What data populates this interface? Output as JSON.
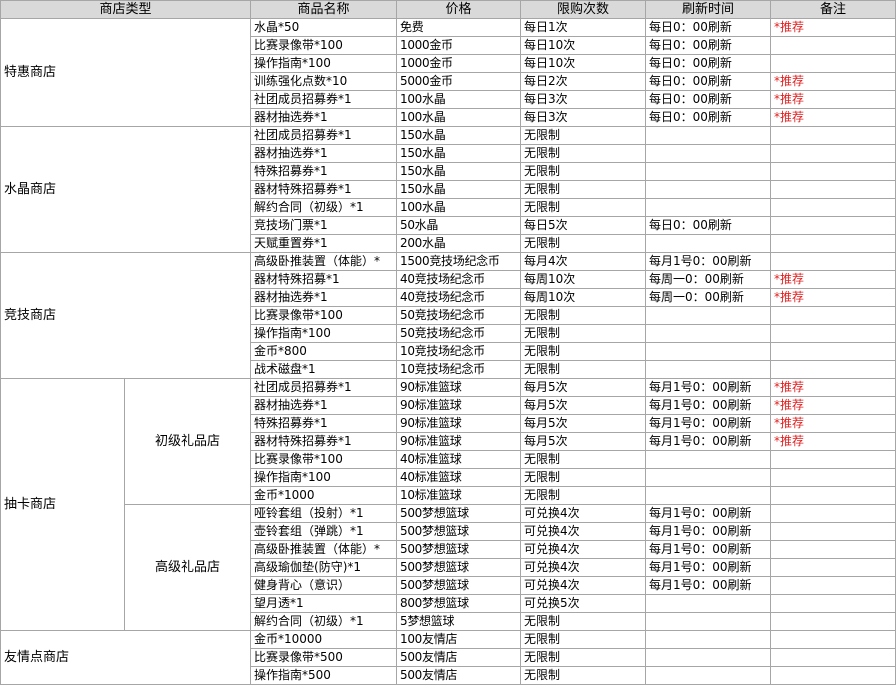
{
  "headers": [
    "商店类型",
    "商品名称",
    "价格",
    "限购次数",
    "刷新时间",
    "备注"
  ],
  "shops": [
    {
      "name": "特惠商店",
      "items": [
        [
          "水晶*50",
          "免费",
          "每日1次",
          "每日0：00刷新",
          "*推荐"
        ],
        [
          "比赛录像带*100",
          "1000金币",
          "每日10次",
          "每日0：00刷新",
          ""
        ],
        [
          "操作指南*100",
          "1000金币",
          "每日10次",
          "每日0：00刷新",
          ""
        ],
        [
          "训练强化点数*10",
          "5000金币",
          "每日2次",
          "每日0：00刷新",
          "*推荐"
        ],
        [
          "社团成员招募券*1",
          "100水晶",
          "每日3次",
          "每日0：00刷新",
          "*推荐"
        ],
        [
          "器材抽选券*1",
          "100水晶",
          "每日3次",
          "每日0：00刷新",
          "*推荐"
        ]
      ]
    },
    {
      "name": "水晶商店",
      "items": [
        [
          "社团成员招募券*1",
          "150水晶",
          "无限制",
          "",
          ""
        ],
        [
          "器材抽选券*1",
          "150水晶",
          "无限制",
          "",
          ""
        ],
        [
          "特殊招募券*1",
          "150水晶",
          "无限制",
          "",
          ""
        ],
        [
          "器材特殊招募券*1",
          "150水晶",
          "无限制",
          "",
          ""
        ],
        [
          "解约合同（初级）*1",
          "100水晶",
          "无限制",
          "",
          ""
        ],
        [
          "竞技场门票*1",
          "50水晶",
          "每日5次",
          "每日0：00刷新",
          ""
        ],
        [
          "天赋重置券*1",
          "200水晶",
          "无限制",
          "",
          ""
        ]
      ]
    },
    {
      "name": "竞技商店",
      "items": [
        [
          "高级卧推装置（体能）*",
          "1500竞技场纪念币",
          "每月4次",
          "每月1号0：00刷新",
          ""
        ],
        [
          "器材特殊招募*1",
          "40竞技场纪念币",
          "每周10次",
          "每周一0：00刷新",
          "*推荐"
        ],
        [
          "器材抽选券*1",
          "40竞技场纪念币",
          "每周10次",
          "每周一0：00刷新",
          "*推荐"
        ],
        [
          "比赛录像带*100",
          "50竞技场纪念币",
          "无限制",
          "",
          ""
        ],
        [
          "操作指南*100",
          "50竞技场纪念币",
          "无限制",
          "",
          ""
        ],
        [
          "金币*800",
          "10竞技场纪念币",
          "无限制",
          "",
          ""
        ],
        [
          "战术磁盘*1",
          "10竞技场纪念币",
          "无限制",
          "",
          ""
        ]
      ]
    },
    {
      "name": "抽卡商店",
      "subs": [
        {
          "name": "初级礼品店",
          "items": [
            [
              "社团成员招募券*1",
              "90标准篮球",
              "每月5次",
              "每月1号0：00刷新",
              "*推荐"
            ],
            [
              "器材抽选券*1",
              "90标准篮球",
              "每月5次",
              "每月1号0：00刷新",
              "*推荐"
            ],
            [
              "特殊招募券*1",
              "90标准篮球",
              "每月5次",
              "每月1号0：00刷新",
              "*推荐"
            ],
            [
              "器材特殊招募券*1",
              "90标准篮球",
              "每月5次",
              "每月1号0：00刷新",
              "*推荐"
            ],
            [
              "比赛录像带*100",
              "40标准篮球",
              "无限制",
              "",
              ""
            ],
            [
              "操作指南*100",
              "40标准篮球",
              "无限制",
              "",
              ""
            ],
            [
              "金币*1000",
              "10标准篮球",
              "无限制",
              "",
              ""
            ]
          ]
        },
        {
          "name": "高级礼品店",
          "items": [
            [
              "哑铃套组（投射）*1",
              "500梦想篮球",
              "可兑换4次",
              "每月1号0：00刷新",
              ""
            ],
            [
              "壶铃套组（弹跳）*1",
              "500梦想篮球",
              "可兑换4次",
              "每月1号0：00刷新",
              ""
            ],
            [
              "高级卧推装置（体能）*",
              "500梦想篮球",
              "可兑换4次",
              "每月1号0：00刷新",
              ""
            ],
            [
              "高级瑜伽垫(防守)*1",
              "500梦想篮球",
              "可兑换4次",
              "每月1号0：00刷新",
              ""
            ],
            [
              "健身背心（意识）",
              "500梦想篮球",
              "可兑换4次",
              "每月1号0：00刷新",
              ""
            ],
            [
              "望月透*1",
              "800梦想篮球",
              "可兑换5次",
              "",
              ""
            ],
            [
              "解约合同（初级）*1",
              "5梦想篮球",
              "无限制",
              "",
              ""
            ]
          ]
        }
      ]
    },
    {
      "name": "友情点商店",
      "items": [
        [
          "金币*10000",
          "100友情店",
          "无限制",
          "",
          ""
        ],
        [
          "比赛录像带*500",
          "500友情店",
          "无限制",
          "",
          ""
        ],
        [
          "操作指南*500",
          "500友情店",
          "无限制",
          "",
          ""
        ]
      ]
    }
  ]
}
